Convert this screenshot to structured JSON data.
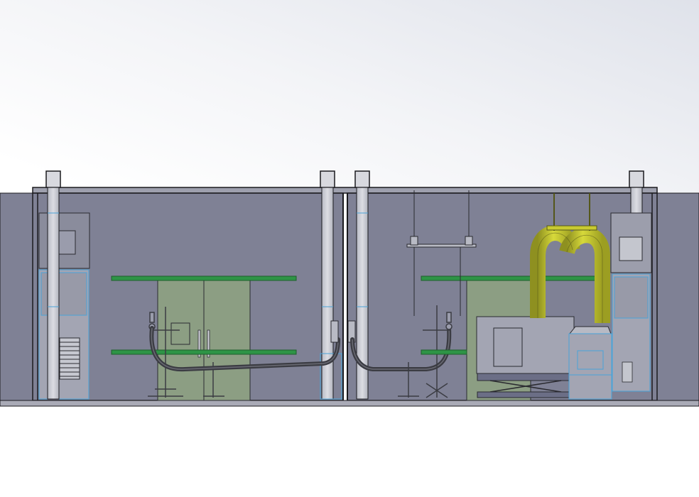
{
  "scene": {
    "view": "side-elevation",
    "background_top": "#dfe2ea",
    "background_bottom": "#ffffff",
    "wall_color": "#7f8195",
    "floor_color": "#a9aab6",
    "outline_color": "#1b1b1f",
    "selection_edge_color": "#4aa3d8",
    "shelf_color": "#2e9446",
    "cabinet_color": "#8c9e83",
    "duct_color": "#cbcd2c",
    "hose_color": "#3b3c43",
    "column_color": "#c9cbd3",
    "equipment_color": "#a3a5b3"
  },
  "components": [
    {
      "name": "left-room"
    },
    {
      "name": "right-room"
    },
    {
      "name": "vertical-column",
      "count": 4
    },
    {
      "name": "green-shelf",
      "count": 4
    },
    {
      "name": "cabinet",
      "count": 2
    },
    {
      "name": "flexible-hose",
      "count": 2
    },
    {
      "name": "hose-stand",
      "count": 2
    },
    {
      "name": "air-handling-unit",
      "count": 2
    },
    {
      "name": "yellow-exhaust-duct",
      "count": 1
    },
    {
      "name": "scissor-lift-table",
      "count": 1
    },
    {
      "name": "overhead-rack",
      "count": 1
    }
  ]
}
